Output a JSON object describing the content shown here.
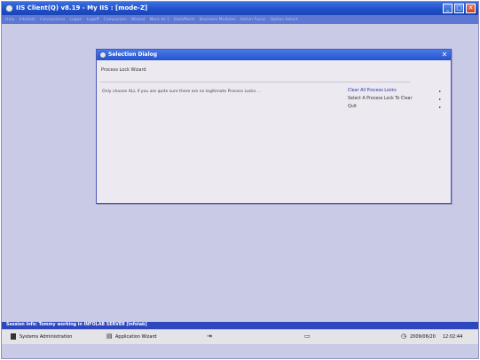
{
  "app": {
    "title": "IIS Client(Q) v8.19 - My IIS :     [mode-Z]"
  },
  "menu": [
    "Help",
    "InfoSets",
    "Connections",
    "Logon",
    "Logoff",
    "Companion",
    "Wizard",
    "More ds 1",
    "DataMarts",
    "Business Modules",
    "Action Focus",
    "Option Select"
  ],
  "dialog": {
    "title": "Selection Dialog",
    "subtitle": "Process Lock Wizard",
    "message": "Only choose ALL if you are quite sure there are no legitimate Process Locks ...",
    "options": [
      {
        "label": "Clear All Process Locks",
        "arrow": "▸"
      },
      {
        "label": "Select A Process Lock To Clear",
        "arrow": "▸"
      },
      {
        "label": "Quit",
        "arrow": "▸"
      }
    ]
  },
  "status": {
    "session_info": "Session Info: Tommy working in INFOLAB SERVER  [infolab]"
  },
  "taskbar": {
    "items": [
      "Systems Administration",
      "Application Wizard"
    ],
    "date": "2009/06/20",
    "time": "12:02:44"
  },
  "colors": {
    "titlebar": "#2552cc",
    "menubar": "#5d77d2",
    "desktop": "#c9cbe6",
    "status": "#2e47bf"
  }
}
